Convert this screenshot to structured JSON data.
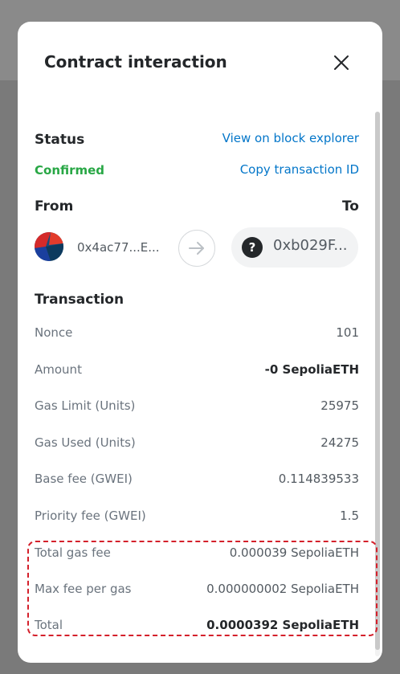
{
  "header": {
    "title": "Contract interaction"
  },
  "status": {
    "label": "Status",
    "value": "Confirmed",
    "explorer_link": "View on block explorer",
    "copy_link": "Copy transaction ID"
  },
  "parties": {
    "from_label": "From",
    "to_label": "To",
    "from_address": "0x4ac77...E...",
    "to_address": "0xb029F..."
  },
  "transaction": {
    "label": "Transaction",
    "rows": [
      {
        "key": "Nonce",
        "value": "101"
      },
      {
        "key": "Amount",
        "value": "-0 SepoliaETH"
      },
      {
        "key": "Gas Limit (Units)",
        "value": "25975"
      },
      {
        "key": "Gas Used (Units)",
        "value": "24275"
      },
      {
        "key": "Base fee (GWEI)",
        "value": "0.114839533"
      },
      {
        "key": "Priority fee (GWEI)",
        "value": "1.5"
      },
      {
        "key": "Total gas fee",
        "value": "0.000039 SepoliaETH"
      },
      {
        "key": "Max fee per gas",
        "value": "0.000000002 SepoliaETH"
      },
      {
        "key": "Total",
        "value": "0.0000392 SepoliaETH"
      }
    ]
  },
  "colors": {
    "link": "#0376c9",
    "confirmed": "#28a745",
    "highlight": "#d4202b"
  },
  "icons": {
    "close": "close-icon",
    "arrow": "arrow-right-icon",
    "unknown": "question-icon"
  }
}
